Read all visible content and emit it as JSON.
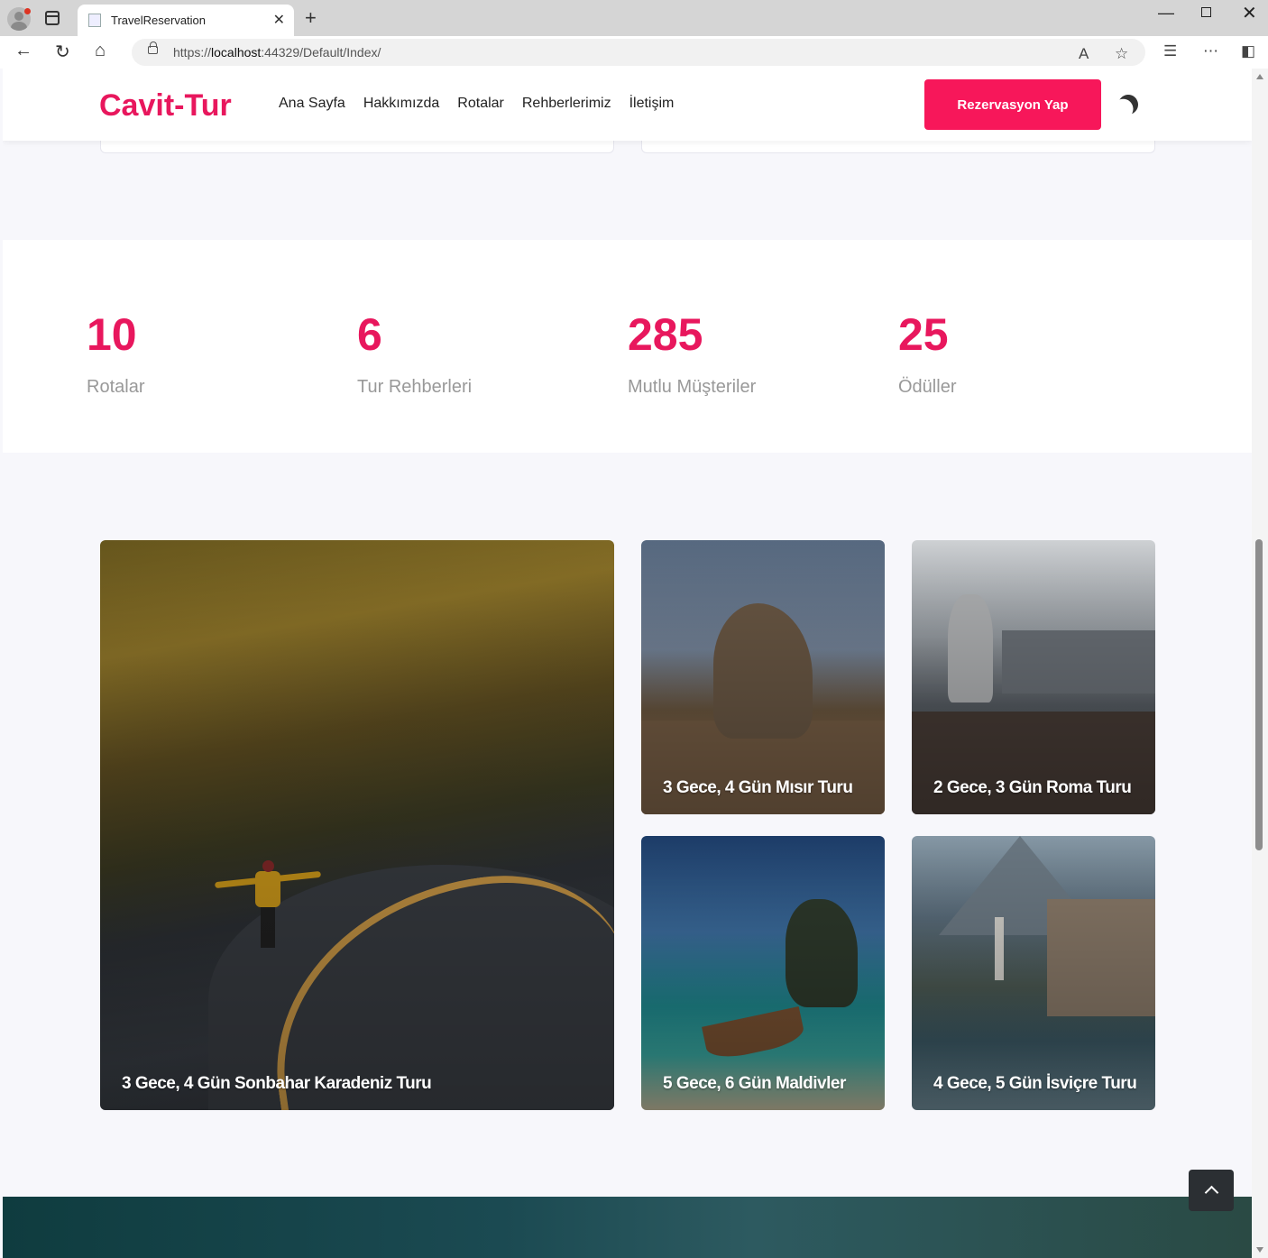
{
  "browser": {
    "tab_title": "TravelReservation",
    "url_prefix": "https://",
    "url_host": "localhost",
    "url_rest": ":44329/Default/Index/"
  },
  "site": {
    "brand": "Cavit-Tur",
    "menu": [
      {
        "label": "Ana Sayfa"
      },
      {
        "label": "Hakkımızda"
      },
      {
        "label": "Rotalar"
      },
      {
        "label": "Rehberlerimiz"
      },
      {
        "label": "İletişim"
      }
    ],
    "cta_label": "Rezervasyon Yap",
    "accent_color": "#e8175d"
  },
  "stats": [
    {
      "value": "10",
      "label": "Rotalar"
    },
    {
      "value": "6",
      "label": "Tur Rehberleri"
    },
    {
      "value": "285",
      "label": "Mutlu Müşteriler"
    },
    {
      "value": "25",
      "label": "Ödüller"
    }
  ],
  "tours": [
    {
      "title": "3 Gece, 4 Gün Sonbahar Karadeniz Turu"
    },
    {
      "title": "3 Gece, 4 Gün Mısır Turu"
    },
    {
      "title": "2 Gece, 3 Gün Roma Turu"
    },
    {
      "title": "5 Gece, 6 Gün Maldivler"
    },
    {
      "title": "4 Gece, 5 Gün İsviçre Turu"
    }
  ]
}
